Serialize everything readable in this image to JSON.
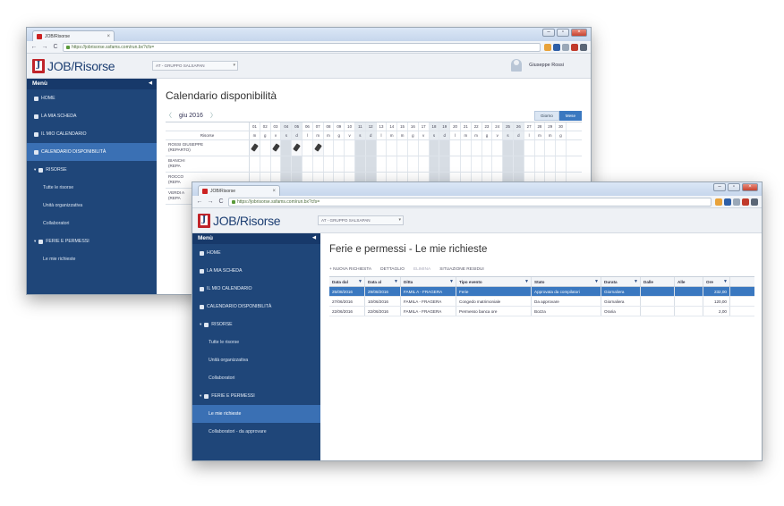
{
  "back_window": {
    "tab_title": "JOB/Risorse",
    "url": "https://jobrisorse.ssfams.com/run.bx?cfs=",
    "app": {
      "logo_text": "JOB/Risorse",
      "company": "AT - GRUPPO SALSAPAN",
      "user_name": "Giuseppe Rossi"
    },
    "menu_title": "Menù",
    "menu": [
      {
        "label": "HOME",
        "type": "item"
      },
      {
        "label": "LA MIA SCHEDA",
        "type": "item"
      },
      {
        "label": "IL MIO CALENDARIO",
        "type": "item"
      },
      {
        "label": "CALENDARIO DISPONIBILITÀ",
        "type": "item",
        "active": true
      },
      {
        "label": "RISORSE",
        "type": "group"
      },
      {
        "label": "Tutte le risorse",
        "type": "sub"
      },
      {
        "label": "Unità organizzativa",
        "type": "sub"
      },
      {
        "label": "Collaboratori",
        "type": "sub"
      },
      {
        "label": "FERIE E PERMESSI",
        "type": "group"
      },
      {
        "label": "Le mie richieste",
        "type": "sub"
      }
    ],
    "calendar": {
      "title": "Calendario disponibilità",
      "month": "giu 2016",
      "view_day": "Giorno",
      "view_month": "Mese",
      "resource_header": "Risorse",
      "days": [
        "01",
        "02",
        "03",
        "04",
        "05",
        "06",
        "07",
        "08",
        "09",
        "10",
        "11",
        "12",
        "13",
        "14",
        "15",
        "16",
        "17",
        "18",
        "19",
        "20",
        "21",
        "22",
        "23",
        "24",
        "25",
        "26",
        "27",
        "28",
        "29",
        "30"
      ],
      "weekdays": [
        "m",
        "g",
        "v",
        "s",
        "d",
        "l",
        "m",
        "m",
        "g",
        "v",
        "s",
        "d",
        "l",
        "m",
        "m",
        "g",
        "v",
        "s",
        "d",
        "l",
        "m",
        "m",
        "g",
        "v",
        "s",
        "d",
        "l",
        "m",
        "m",
        "g"
      ],
      "resources": [
        {
          "name": "ROSSI GIUSEPPE",
          "dept": "(REPARTO)"
        },
        {
          "name": "BIANCHI",
          "dept": "(REPA"
        },
        {
          "name": "ROCCO",
          "dept": "(REPA"
        },
        {
          "name": "VERDI A",
          "dept": "(REPA"
        }
      ]
    }
  },
  "front_window": {
    "tab_title": "JOB/Risorse",
    "url": "https://jobrisorse.ssfams.com/run.bx?cfs=",
    "app": {
      "logo_text": "JOB/Risorse",
      "company": "AT - GRUPPO SALSAPAN"
    },
    "menu_title": "Menù",
    "menu": [
      {
        "label": "HOME",
        "type": "item"
      },
      {
        "label": "LA MIA SCHEDA",
        "type": "item"
      },
      {
        "label": "IL MIO CALENDARIO",
        "type": "item"
      },
      {
        "label": "CALENDARIO DISPONIBILITÀ",
        "type": "item"
      },
      {
        "label": "RISORSE",
        "type": "group"
      },
      {
        "label": "Tutte le risorse",
        "type": "sub"
      },
      {
        "label": "Unità organizzativa",
        "type": "sub"
      },
      {
        "label": "Collaboratori",
        "type": "sub"
      },
      {
        "label": "FERIE E PERMESSI",
        "type": "group"
      },
      {
        "label": "Le mie richieste",
        "type": "sub",
        "active": true
      },
      {
        "label": "Collaboratori - da approvare",
        "type": "sub"
      }
    ],
    "requests": {
      "title": "Ferie e permessi - Le mie richieste",
      "toolbar": {
        "new": "+ NUOVA RICHIESTA",
        "detail": "DETTAGLIO",
        "delete": "ELIMINA",
        "status": "SITUAZIONE RESIDUI"
      },
      "columns": [
        "Data dal",
        "Data al",
        "Ditta",
        "Tipo evento",
        "Stato",
        "Durata",
        "Dalle",
        "Alle",
        "Ore"
      ],
      "rows": [
        {
          "dal": "25/08/2016",
          "al": "29/08/2016",
          "ditta": "FAMIL A - FRAGERA",
          "tipo": "Ferie",
          "stato": "Approvata da compilatori",
          "durata": "Giornaliera",
          "dalle": "",
          "alle": "",
          "ore": "232,00",
          "selected": true
        },
        {
          "dal": "27/06/2016",
          "al": "10/06/2016",
          "ditta": "FAMILA - FRAGERA",
          "tipo": "Congedo matrimoniale",
          "stato": "Da approvare",
          "durata": "Giornaliera",
          "dalle": "",
          "alle": "",
          "ore": "120,00",
          "selected": false
        },
        {
          "dal": "22/06/2016",
          "al": "22/06/2016",
          "ditta": "FAMILA - FRAGERA",
          "tipo": "Permesso banca ore",
          "stato": "Bozza",
          "durata": "Oraria",
          "dalle": "",
          "alle": "",
          "ore": "2,00",
          "selected": false
        }
      ]
    }
  }
}
